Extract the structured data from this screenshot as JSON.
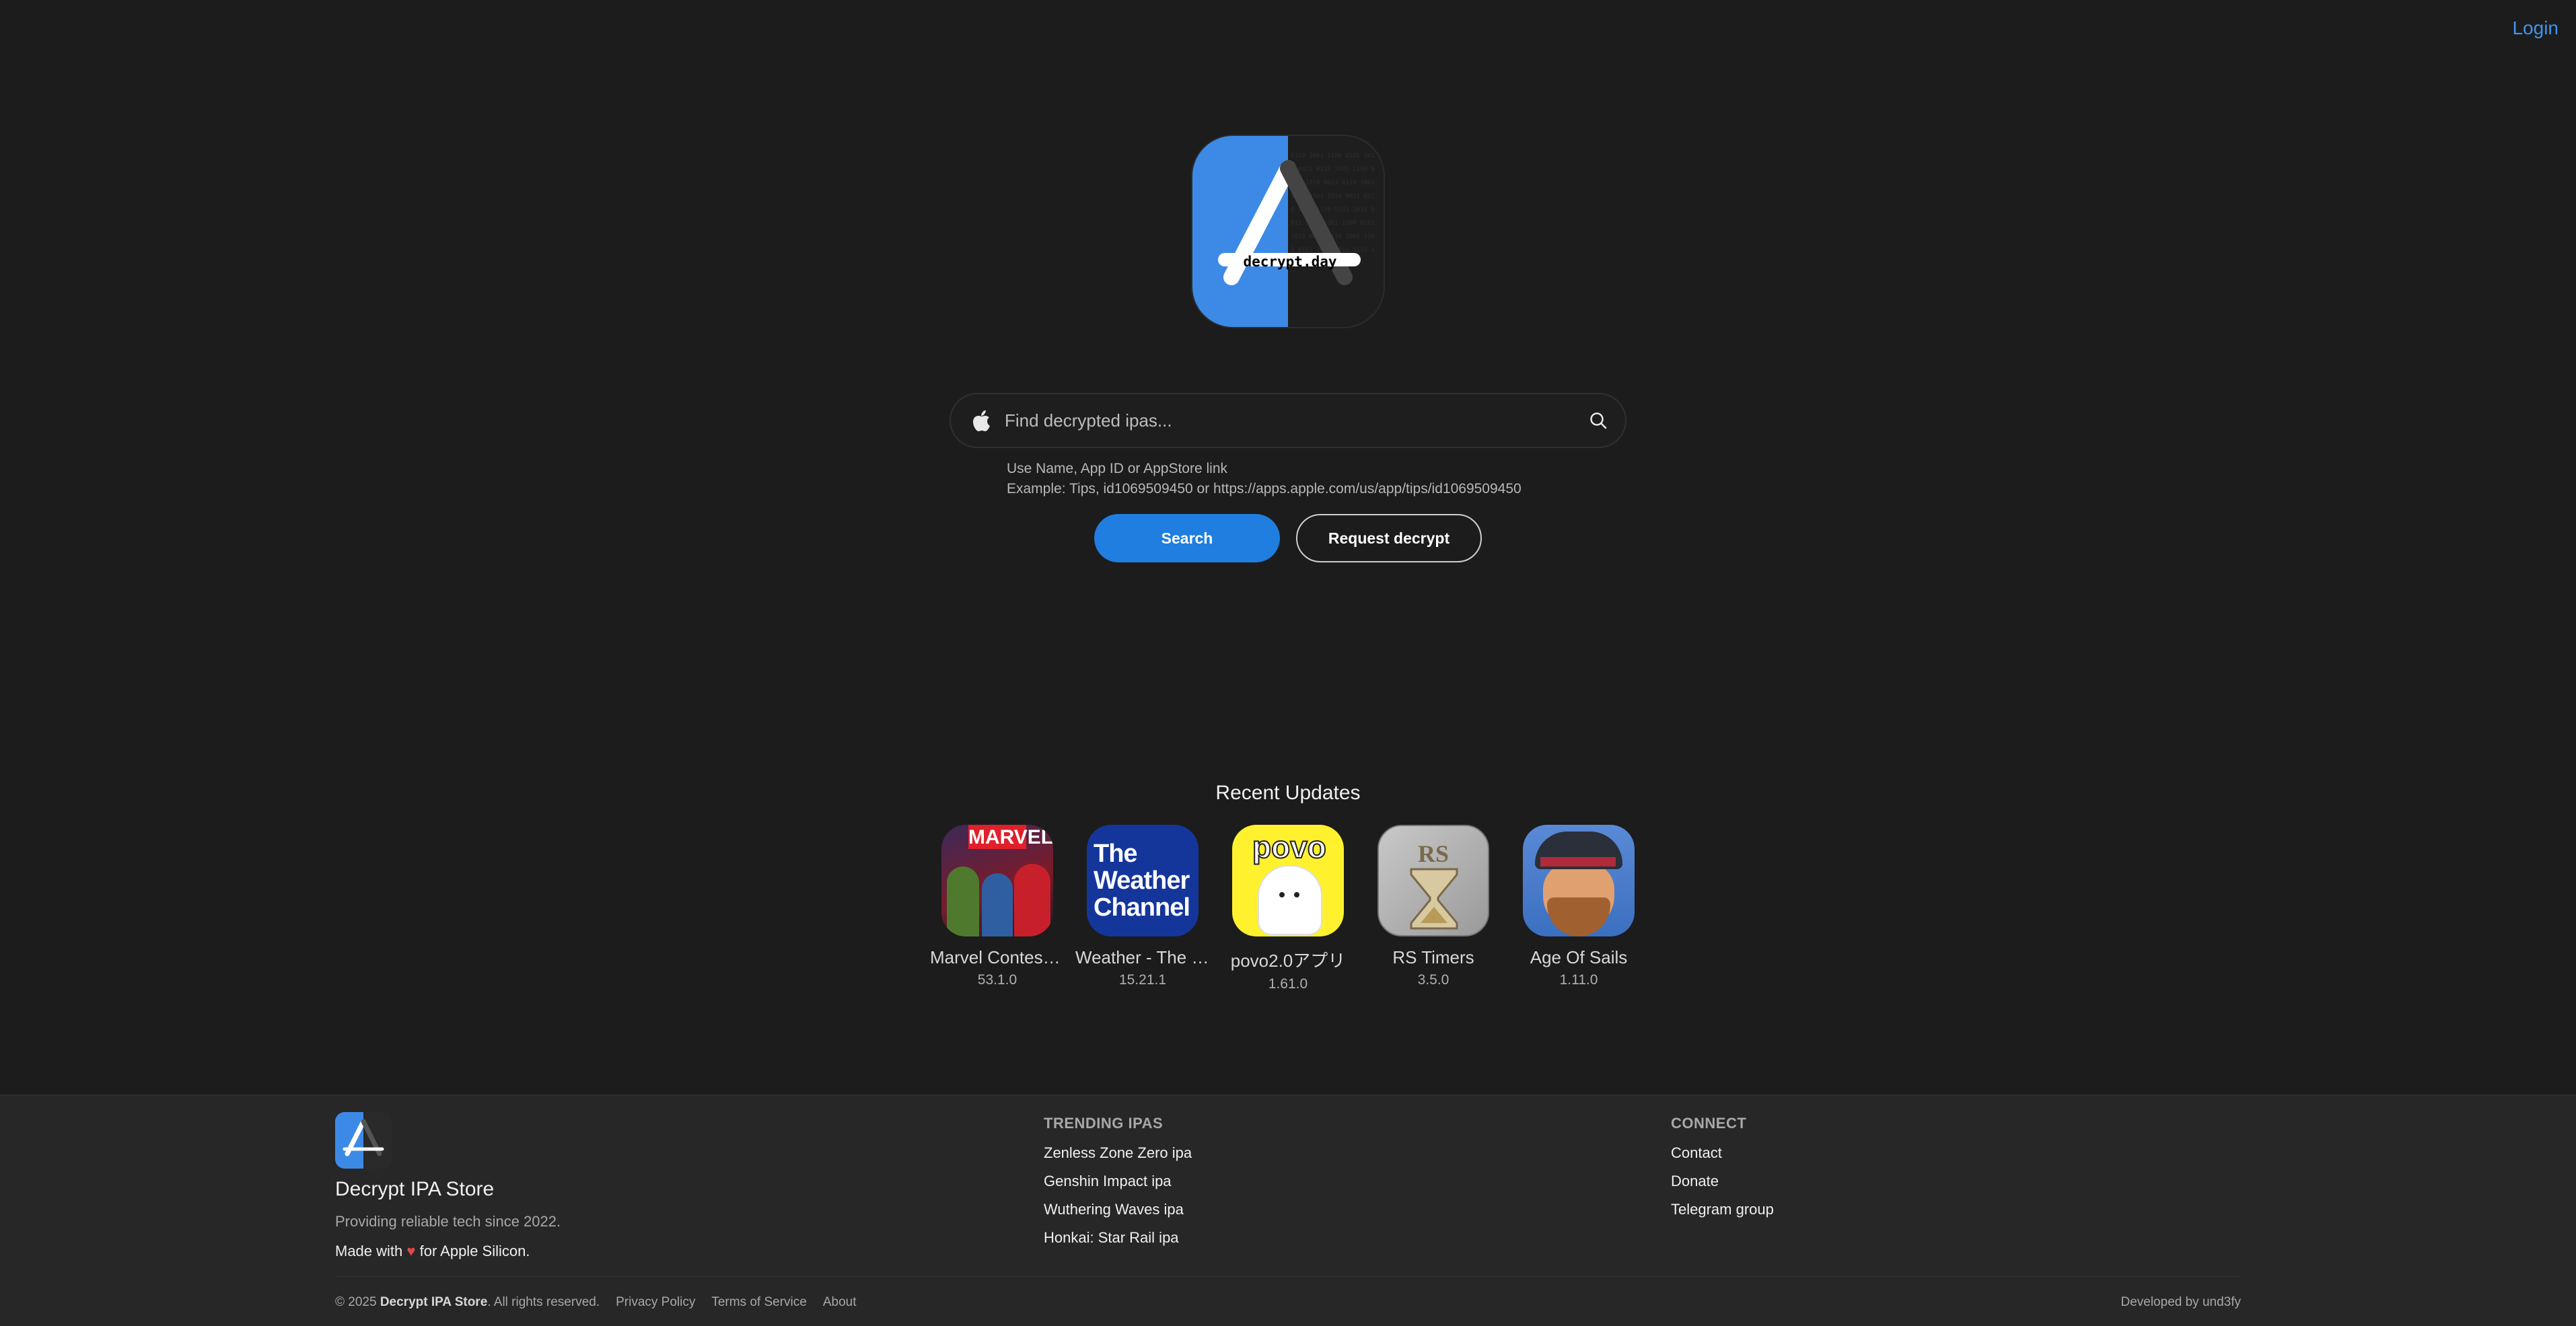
{
  "header": {
    "login_label": "Login"
  },
  "logo": {
    "text": "decrypt.day"
  },
  "search": {
    "placeholder": "Find decrypted ipas...",
    "hint_line1": "Use Name, App ID or AppStore link",
    "hint_line2": "Example: Tips, id1069509450 or https://apps.apple.com/us/app/tips/id1069509450",
    "search_button": "Search",
    "request_button": "Request decrypt"
  },
  "recent": {
    "title": "Recent Updates",
    "apps": [
      {
        "name": "Marvel Contest of Champions",
        "version": "53.1.0",
        "icon": "marvel-icon"
      },
      {
        "name": "Weather - The Weather Channel",
        "version": "15.21.1",
        "icon": "weather-channel-icon"
      },
      {
        "name": "povo2.0アプリ",
        "version": "1.61.0",
        "icon": "povo-icon"
      },
      {
        "name": "RS Timers",
        "version": "3.5.0",
        "icon": "hourglass-icon"
      },
      {
        "name": "Age Of Sails",
        "version": "1.11.0",
        "icon": "pirate-icon"
      }
    ],
    "icon_text": {
      "marvel": "MARVEL",
      "weather_1": "The",
      "weather_2": "Weather",
      "weather_3": "Channel",
      "povo": "povo",
      "rs": "RS"
    }
  },
  "footer": {
    "brand": "Decrypt IPA Store",
    "tagline": "Providing reliable tech since 2022.",
    "made_prefix": "Made with",
    "made_heart": "♥",
    "made_suffix": "for Apple Silicon.",
    "trending_title": "TRENDING IPAS",
    "trending": [
      "Zenless Zone Zero ipa",
      "Genshin Impact ipa",
      "Wuthering Waves ipa",
      "Honkai: Star Rail ipa"
    ],
    "connect_title": "CONNECT",
    "connect": [
      "Contact",
      "Donate",
      "Telegram group"
    ],
    "copyright_prefix": "© 2025",
    "copyright_brand": "Decrypt IPA Store",
    "copyright_suffix": ". All rights reserved.",
    "links": [
      "Privacy Policy",
      "Terms of Service",
      "About"
    ],
    "developed_by": "Developed by und3fy"
  },
  "colors": {
    "accent": "#1f7ee0",
    "link": "#3d95f0",
    "background": "#1c1c1c",
    "footer": "#272727",
    "heart": "#e04848"
  }
}
